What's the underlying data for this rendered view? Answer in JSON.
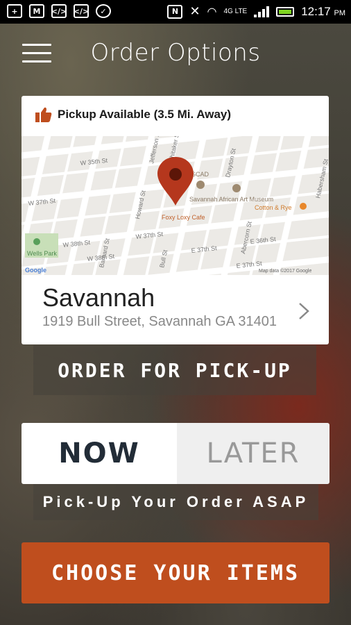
{
  "status_bar": {
    "time": "12:17",
    "ampm": "PM",
    "network": "4G LTE",
    "icons": [
      "add-icon",
      "gmail-icon",
      "code-icon",
      "code-icon",
      "messenger-icon",
      "nfc-icon",
      "mute-icon",
      "wifi-icon",
      "signal-icon",
      "battery-icon"
    ]
  },
  "header": {
    "title": "Order Options",
    "menu_icon": "hamburger-menu-icon"
  },
  "location_card": {
    "availability": "Pickup Available (3.5 Mi. Away)",
    "name": "Savannah",
    "address": "1919 Bull Street, Savannah GA 31401",
    "map": {
      "streets": [
        "W 35th St",
        "W 37th St",
        "W 37th St",
        "W 38th St",
        "W 38th St",
        "E 37th St",
        "E 37th St",
        "E 36th St",
        "Barnard St",
        "Howard St",
        "Whitaker St",
        "Drayton St",
        "Abercorn St",
        "Habersham St",
        "Bull St",
        "Jefferson St"
      ],
      "places": [
        "Foxy Loxy Cafe",
        "Savannah African Art Museum",
        "Cotton & Rye",
        "Wells Park",
        "SCAD"
      ],
      "attribution": "Map data ©2017 Google",
      "google": "Google"
    }
  },
  "buttons": {
    "order_pickup": "ORDER FOR PICK-UP",
    "choose_items": "CHOOSE YOUR ITEMS"
  },
  "timing": {
    "now": "NOW",
    "later": "LATER",
    "selected": "NOW",
    "note": "Pick-Up Your Order ASAP"
  },
  "colors": {
    "accent": "#bf4e1e",
    "pin": "#b5371d",
    "now_text": "#222c37"
  }
}
